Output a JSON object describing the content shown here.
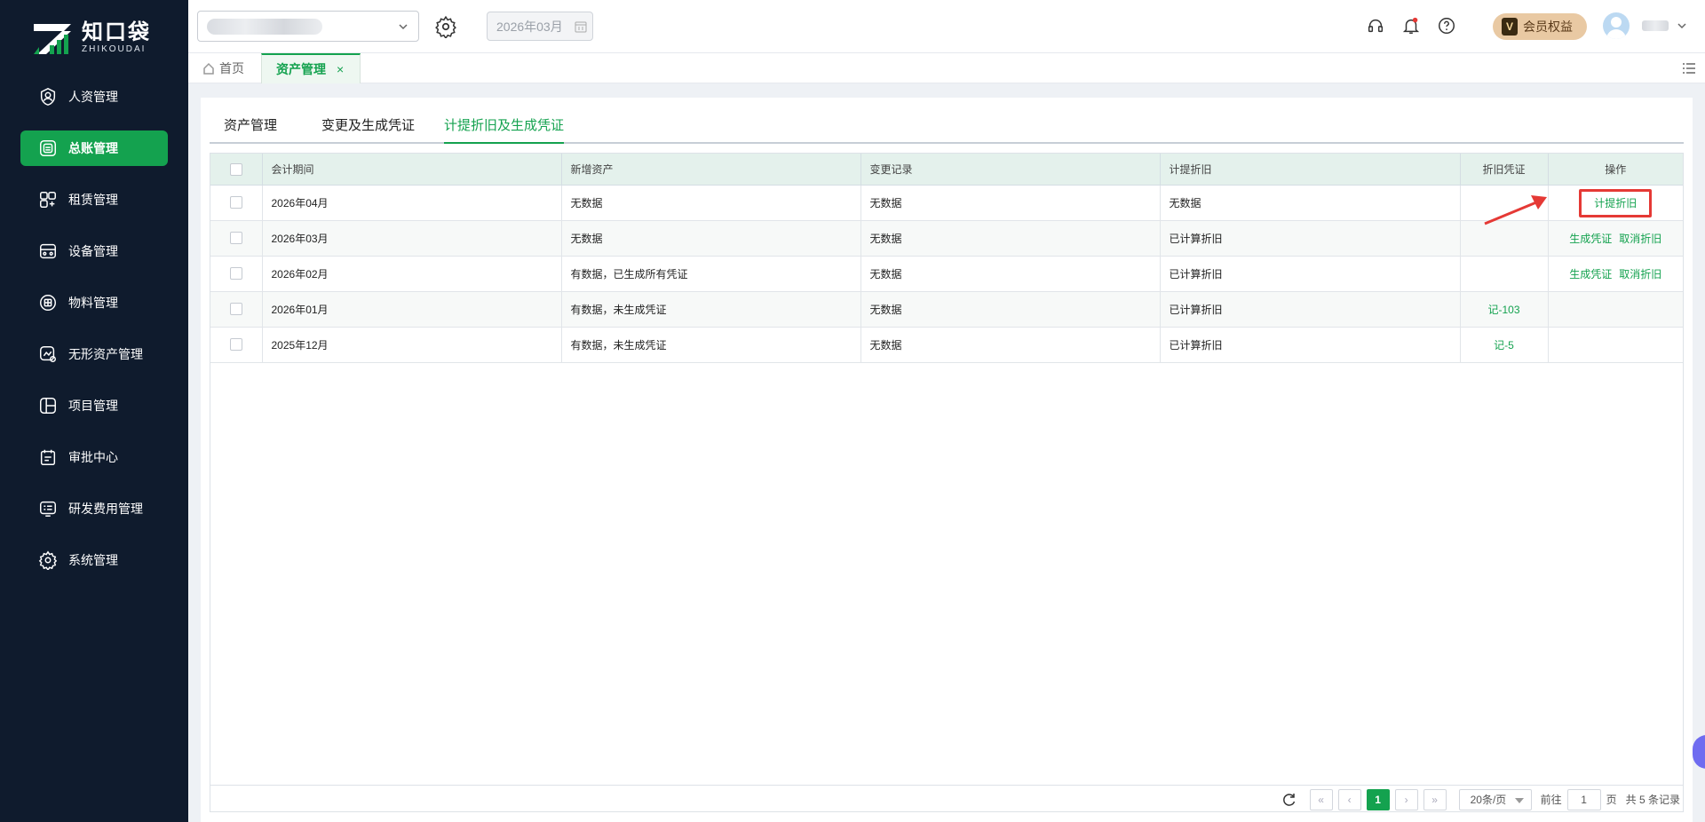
{
  "logo": {
    "cn": "知口袋",
    "en": "ZHIKOUDAI"
  },
  "sidebar": {
    "items": [
      {
        "label": "人资管理",
        "icon": "user-shield-icon"
      },
      {
        "label": "总账管理",
        "icon": "ledger-icon",
        "active": true
      },
      {
        "label": "租赁管理",
        "icon": "lease-icon"
      },
      {
        "label": "设备管理",
        "icon": "device-icon"
      },
      {
        "label": "物料管理",
        "icon": "material-icon"
      },
      {
        "label": "无形资产管理",
        "icon": "intangible-asset-icon"
      },
      {
        "label": "项目管理",
        "icon": "project-icon"
      },
      {
        "label": "审批中心",
        "icon": "approval-icon"
      },
      {
        "label": "研发费用管理",
        "icon": "rd-expense-icon"
      },
      {
        "label": "系统管理",
        "icon": "gear-icon"
      }
    ]
  },
  "header": {
    "period": "2026年03月",
    "member_label": "会员权益",
    "member_badge": "V"
  },
  "tabs": {
    "home": "首页",
    "active": "资产管理",
    "close": "×"
  },
  "subtabs": [
    "资产管理",
    "变更及生成凭证",
    "计提折旧及生成凭证"
  ],
  "table": {
    "columns": [
      "会计期间",
      "新增资产",
      "变更记录",
      "计提折旧",
      "折旧凭证",
      "操作"
    ],
    "rows": [
      {
        "period": "2026年04月",
        "new_asset": "无数据",
        "change": "无数据",
        "depreciation": "无数据",
        "voucher": "",
        "actions": [
          "计提折旧"
        ]
      },
      {
        "period": "2026年03月",
        "new_asset": "无数据",
        "change": "无数据",
        "depreciation": "已计算折旧",
        "voucher": "",
        "actions": [
          "生成凭证",
          "取消折旧"
        ]
      },
      {
        "period": "2026年02月",
        "new_asset": "有数据，已生成所有凭证",
        "change": "无数据",
        "depreciation": "已计算折旧",
        "voucher": "",
        "actions": [
          "生成凭证",
          "取消折旧"
        ]
      },
      {
        "period": "2026年01月",
        "new_asset": "有数据，未生成凭证",
        "change": "无数据",
        "depreciation": "已计算折旧",
        "voucher": "记-103",
        "actions": []
      },
      {
        "period": "2025年12月",
        "new_asset": "有数据，未生成凭证",
        "change": "无数据",
        "depreciation": "已计算折旧",
        "voucher": "记-5",
        "actions": []
      }
    ]
  },
  "pager": {
    "current_page": "1",
    "page_size": "20条/页",
    "goto_label": "前往",
    "goto_value": "1",
    "page_unit": "页",
    "total": "共 5 条记录"
  },
  "colors": {
    "accent": "#14a24f",
    "sidebar": "#0f1b2d",
    "highlight": "#e53935"
  }
}
